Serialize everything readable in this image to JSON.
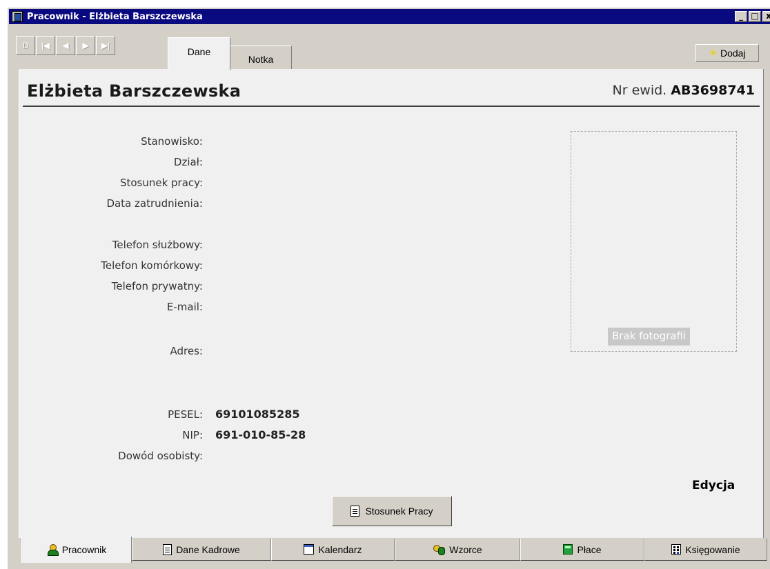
{
  "window": {
    "title": "Pracownik - Elżbieta Barszczewska",
    "minimize": "_",
    "maximize": "□",
    "close": "x"
  },
  "nav_buttons": [
    "D",
    "|◀",
    "◀",
    "▶",
    "▶|"
  ],
  "top_tabs": [
    {
      "label": "Dane",
      "active": true
    },
    {
      "label": "Notka",
      "active": false
    }
  ],
  "add_button": {
    "label": "Dodaj",
    "icon": "star-icon"
  },
  "employee": {
    "name": "Elżbieta Barszczewska",
    "nr_label": "Nr ewid.",
    "nr_value": "AB3698741"
  },
  "fields": {
    "stanowisko": "Stanowisko:",
    "dzial": "Dział:",
    "stosunek": "Stosunek pracy:",
    "data_zatr": "Data zatrudnienia:",
    "tel_sluzbowy": "Telefon służbowy:",
    "tel_komorkowy": "Telefon komórkowy:",
    "tel_prywatny": "Telefon prywatny:",
    "email": "E-mail:",
    "adres": "Adres:",
    "pesel": "PESEL:",
    "nip": "NIP:",
    "dowod": "Dowód osobisty:"
  },
  "values": {
    "pesel": "69101085285",
    "nip": "691-010-85-28"
  },
  "photo": {
    "caption": "Brak fotografii"
  },
  "edycja": "Edycja",
  "stosunek_button": "Stosunek Pracy",
  "bottom_tabs": [
    {
      "label": "Pracownik",
      "icon": "person-icon",
      "active": true
    },
    {
      "label": "Dane Kadrowe",
      "icon": "document-icon",
      "active": false
    },
    {
      "label": "Kalendarz",
      "icon": "calendar-icon",
      "active": false
    },
    {
      "label": "Wzorce",
      "icon": "people-icon",
      "active": false
    },
    {
      "label": "Płace",
      "icon": "calculator-icon",
      "active": false
    },
    {
      "label": "Księgowanie",
      "icon": "ledger-icon",
      "active": false
    }
  ]
}
